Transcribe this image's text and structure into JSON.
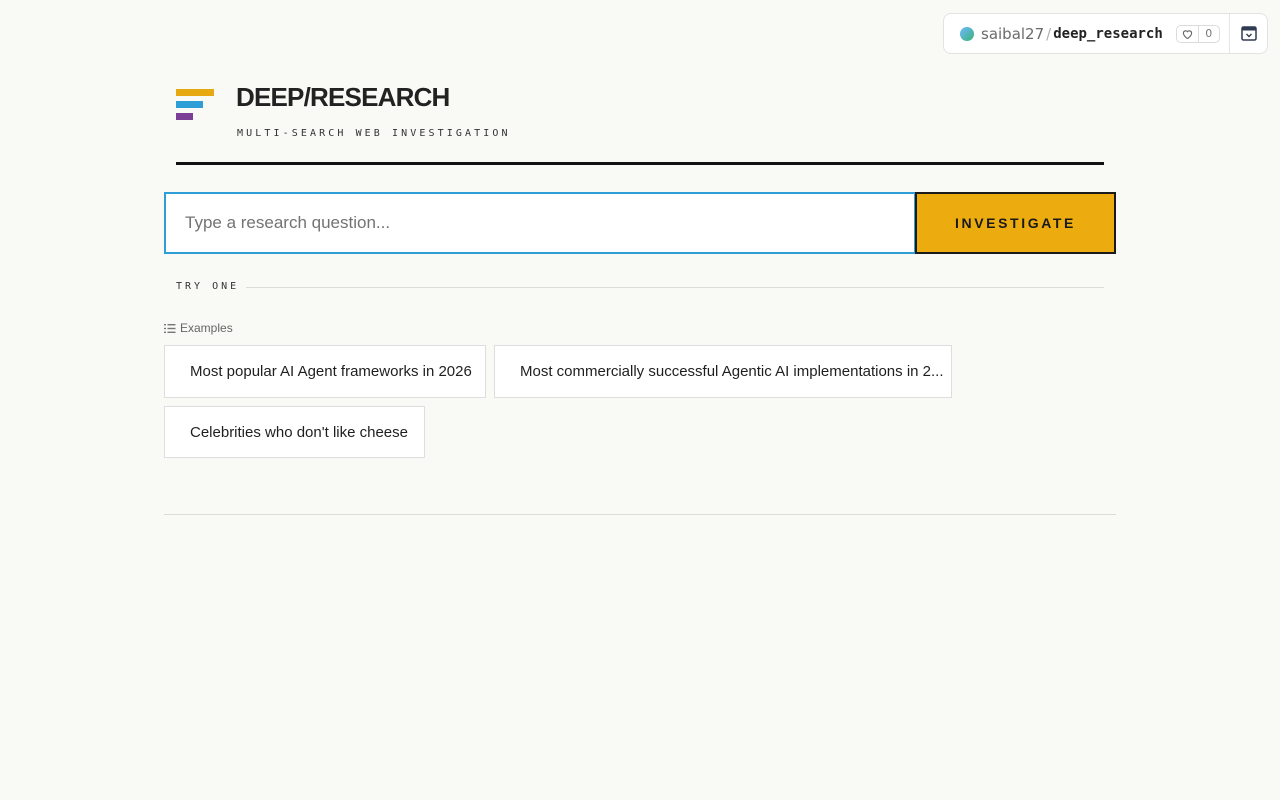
{
  "repo": {
    "owner": "saibal27",
    "separator": "/",
    "name": "deep_research",
    "likes": "0"
  },
  "header": {
    "title": "DEEP/RESEARCH",
    "subtitle": "MULTI-SEARCH WEB INVESTIGATION"
  },
  "search": {
    "placeholder": "Type a research question...",
    "value": "",
    "button_label": "INVESTIGATE"
  },
  "try_one": {
    "label": "TRY ONE",
    "examples_label": "Examples",
    "examples": [
      "Most popular AI Agent frameworks in 2026",
      "Most commercially successful Agentic AI implementations in 2...",
      "Celebrities who don't like cheese"
    ]
  },
  "colors": {
    "accent_yellow": "#ecac0f",
    "accent_blue": "#2e9fd6",
    "accent_purple": "#7b3f98",
    "background": "#f9f9f6"
  }
}
